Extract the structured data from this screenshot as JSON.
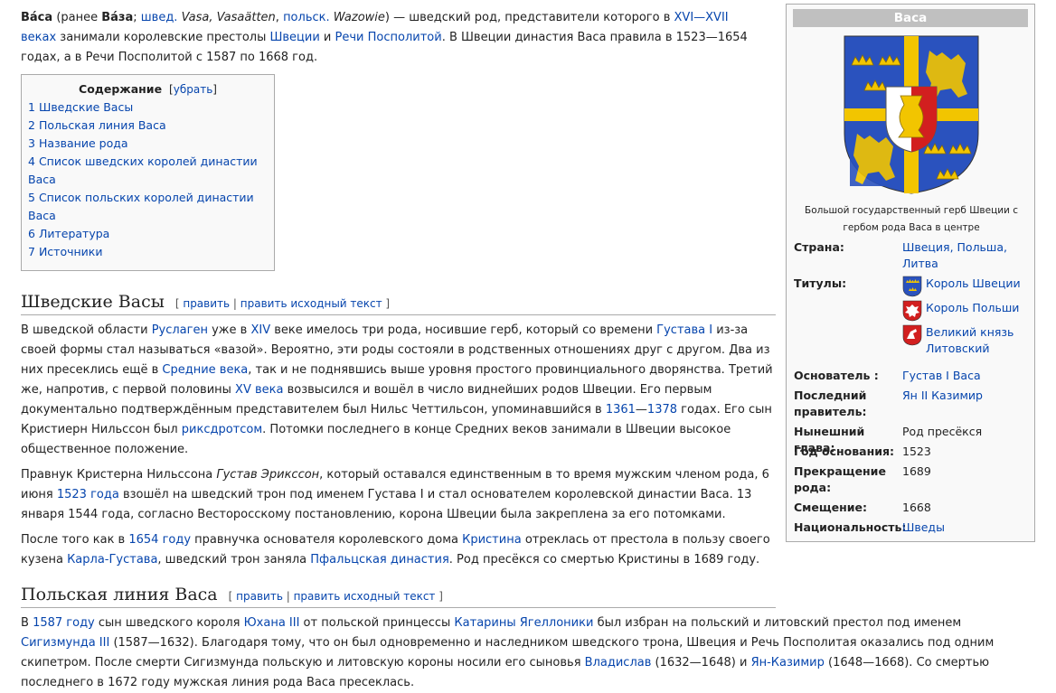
{
  "intro": {
    "name": "Ва́са",
    "former_prefix": "(ранее ",
    "former_name": "Ва́за",
    "semicolon": "; ",
    "lang_swe": "швед.",
    "swe_names": " Vasa, Vasaätten",
    "comma": ", ",
    "lang_pol": "польск.",
    "pol_name": " Wazowie",
    "text1": ") — шведский род, представители которого в ",
    "link_xvi_xvii": "XVI—XVII веках",
    "text2": " занимали королевские престолы ",
    "link_sweden": "Швеции",
    "text_and": " и ",
    "link_rzecz": "Речи Посполитой",
    "text3": ". В Швеции династия Васа правила в 1523—1654 годах, а в Речи Посполитой с 1587 по 1668 год."
  },
  "toc": {
    "title": "Содержание",
    "toggle": "[убрать]",
    "items": [
      {
        "num": "1",
        "label": "Шведские Васы"
      },
      {
        "num": "2",
        "label": "Польская линия Васа"
      },
      {
        "num": "3",
        "label": "Название рода"
      },
      {
        "num": "4",
        "label": "Список шведских королей династии Васа"
      },
      {
        "num": "5",
        "label": "Список польских королей династии Васа"
      },
      {
        "num": "6",
        "label": "Литература"
      },
      {
        "num": "7",
        "label": "Источники"
      }
    ]
  },
  "edit": {
    "open": "[ ",
    "edit": "править",
    "sep": " | ",
    "source": "править исходный текст",
    "close": " ]"
  },
  "sec1": {
    "heading": "Шведские Васы",
    "p1": {
      "t1": "В шведской области ",
      "l1": "Руслаген",
      "t2": " уже в ",
      "l2": "XIV",
      "t3": " веке имелось три рода, носившие герб, который со времени ",
      "l3": "Густава I",
      "t4": " из-за своей формы стал называться «вазой». Вероятно, эти роды состояли в родственных отношениях друг с другом. Два из них пресеклись ещё в ",
      "l4": "Средние века",
      "t5": ", так и не поднявшись выше уровня простого провинциального дворянства. Третий же, напротив, с первой половины ",
      "l5": "XV века",
      "t6": " возвысился и вошёл в число виднейших родов Швеции. Его первым документально подтверждённым представителем был Нильс Четтильсон, упоминавшийся в ",
      "l6": "1361",
      "t7": "—",
      "l7": "1378",
      "t8": " годах. Его сын Кристиерн Нильссон был ",
      "l8": "риксдротсом",
      "t9": ". Потомки последнего в конце Средних веков занимали в Швеции высокое общественное положение."
    },
    "p2": {
      "t1": "Правнук Кристерна Нильссона ",
      "i1": "Густав Эрикссон",
      "t2": ", который оставался единственным в то время мужским членом рода, 6 июня ",
      "l1": "1523 года",
      "t3": " взошёл на шведский трон под именем Густава I и стал основателем королевской династии Васа. 13 января 1544 года, согласно Весторосскому постановлению, корона Швеции была закреплена за его потомками."
    },
    "p3": {
      "t1": "После того как в ",
      "l1": "1654 году",
      "t2": " правнучка основателя королевского дома ",
      "l2": "Кристина",
      "t3": " отреклась от престола в пользу своего кузена ",
      "l3": "Карла-Густава",
      "t4": ", шведский трон заняла ",
      "l4": "Пфальцская династия",
      "t5": ". Род пресёкся со смертью Кристины в 1689 году."
    }
  },
  "sec2": {
    "heading": "Польская линия Васа",
    "p1": {
      "t1": "В ",
      "l1": "1587 году",
      "t2": " сын шведского короля ",
      "l2": "Юхана III",
      "t3": " от польской принцессы ",
      "l3": "Катарины Ягеллоники",
      "t4": " был избран на польский и литовский престол под именем ",
      "l4": "Сигизмунда III",
      "t5": " (1587—1632). Благодаря тому, что он был одновременно и наследником шведского трона, Швеция и Речь Посполитая оказались под одним скипетром. После смерти Сигизмунда польскую и литовскую короны носили его сыновья ",
      "l5": "Владислав",
      "t6": " (1632—1648) и ",
      "l6": "Ян-Казимир",
      "t7": " (1648—1668). Со смертью последнего в 1672 году мужская линия рода Васа пресеклась."
    }
  },
  "infobox": {
    "title": "Васа",
    "caption": "Большой государственный герб Швеции с гербом рода Васа в центре",
    "country_label": "Страна:",
    "country_value": "Швеция, Польша, Литва",
    "titles_label": "Титулы:",
    "titles": [
      "Король Швеции",
      "Король Польши",
      "Великий князь Литовский"
    ],
    "founder_label": "Основатель :",
    "founder_value": "Густав I Васа",
    "last_label": "Последний правитель:",
    "last_value": "Ян II Казимир",
    "head_label": "Нынешний глава:",
    "head_value": "Род пресёкся",
    "founded_label": "Год основания:",
    "founded_value": "1523",
    "ended_label": "Прекращение рода:",
    "ended_value": "1689",
    "deposed_label": "Смещение:",
    "deposed_value": "1668",
    "nation_label": "Национальность:",
    "nation_value": "Шведы"
  },
  "colors": {
    "link": "#0645ad",
    "shield_blue": "#2a52be",
    "gold": "#f2c500",
    "red": "#d21f1f",
    "box_border": "#aaaaaa",
    "box_bg": "#f9f9f9",
    "title_bg": "#c0c0c0"
  }
}
